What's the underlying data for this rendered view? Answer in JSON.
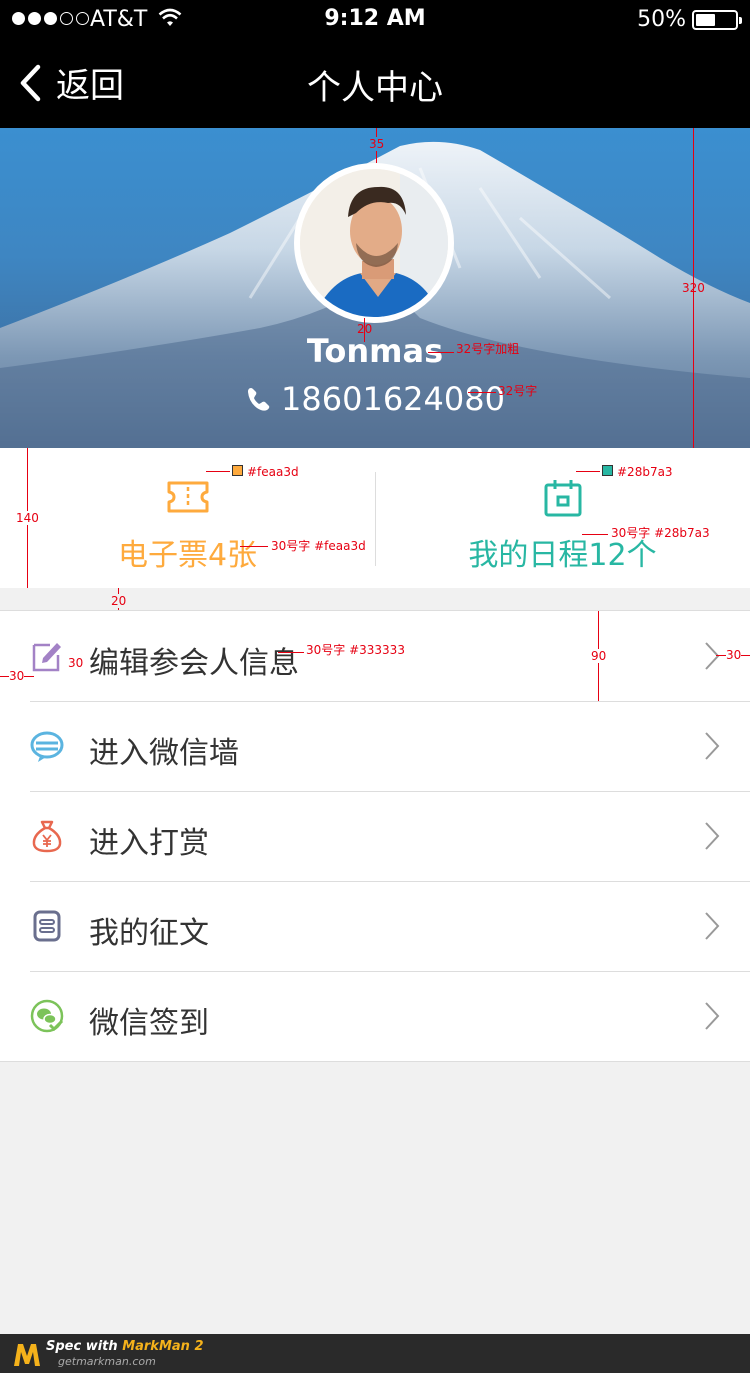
{
  "status_bar": {
    "carrier": "AT&T",
    "time": "9:12 AM",
    "battery_text": "50%",
    "battery_level": 0.5,
    "signal_bars": 3,
    "signal_total": 5
  },
  "nav": {
    "back_label": "返回",
    "title": "个人中心"
  },
  "profile": {
    "name": "Tonmas",
    "phone": "18601624080"
  },
  "summary": {
    "tickets_label": "电子票4张",
    "tickets_color": "#feaa3d",
    "schedule_label": "我的日程12个",
    "schedule_color": "#28b7a3"
  },
  "menu": {
    "items": [
      {
        "label": "编辑参会人信息",
        "icon": "edit-icon",
        "color": "#a382c6"
      },
      {
        "label": "进入微信墙",
        "icon": "chat-wall-icon",
        "color": "#5bb4e0"
      },
      {
        "label": "进入打赏",
        "icon": "money-bag-icon",
        "color": "#e8684f"
      },
      {
        "label": "我的征文",
        "icon": "document-icon",
        "color": "#6a6f8e"
      },
      {
        "label": "微信签到",
        "icon": "wechat-checkin-icon",
        "color": "#7cc35a"
      }
    ]
  },
  "annotations": {
    "avatar_top": "35",
    "hero_height": "320",
    "name_gap": "20",
    "name_spec": "32号字加粗",
    "phone_spec": "32号字",
    "tickets_icon_color": "#feaa3d",
    "schedule_icon_color": "#28b7a3",
    "tickets_text_spec": "30号字 #feaa3d",
    "schedule_text_spec": "30号字 #28b7a3",
    "summary_height": "140",
    "section_gap": "20",
    "row_text_spec": "30号字 #333333",
    "row_height": "90",
    "icon_gap": "30",
    "left_margin": "30",
    "right_margin": "30"
  },
  "footer": {
    "spec_with": "Spec with",
    "markman": "MarkMan 2",
    "url": "getmarkman.com"
  }
}
